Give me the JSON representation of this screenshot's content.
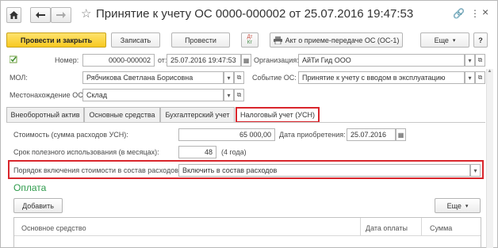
{
  "window": {
    "title": "Принятие к учету ОС 0000-000002 от 25.07.2016 19:47:53",
    "controls": {
      "link": "🔗",
      "more": "⋮",
      "close": "×"
    }
  },
  "nav": {
    "home_icon": "home-icon",
    "back_icon": "arrow-left-icon",
    "forward_icon": "arrow-right-icon"
  },
  "toolbar": {
    "post_and_close": "Провести и закрыть",
    "save": "Записать",
    "post": "Провести",
    "dtkt_top": "Дт",
    "dtkt_bottom": "Кт",
    "act_print": "Акт о приеме-передаче ОС (ОС-1)",
    "more": "Еще",
    "help": "?"
  },
  "header": {
    "number_label": "Номер:",
    "number_value": "0000-000002",
    "date_label": "от:",
    "date_value": "25.07.2016 19:47:53",
    "org_label": "Организация:",
    "org_value": "АйТи Гид ООО",
    "mol_label": "МОЛ:",
    "mol_value": "Рябчикова Светлана Борисовна",
    "event_label": "Событие ОС:",
    "event_value": "Принятие к учету с вводом в эксплуатацию",
    "location_label": "Местонахождение ОС:",
    "location_value": "Склад"
  },
  "tabs": [
    {
      "label": "Внеоборотный актив"
    },
    {
      "label": "Основные средства"
    },
    {
      "label": "Бухгалтерский учет"
    },
    {
      "label": "Налоговый учет (УСН)"
    }
  ],
  "tax": {
    "cost_label": "Стоимость (сумма расходов УСН):",
    "cost_value": "65 000,00",
    "acq_date_label": "Дата приобретения:",
    "acq_date_value": "25.07.2016",
    "life_label": "Срок полезного использования (в месяцах):",
    "life_value": "48",
    "life_years": "(4 года)",
    "order_label": "Порядок включения стоимости в состав расходов:",
    "order_value": "Включить в состав расходов"
  },
  "payment": {
    "title": "Оплата",
    "add_button": "Добавить",
    "more": "Еще",
    "columns": [
      "Основное средство",
      "Дата оплаты",
      "Сумма"
    ]
  }
}
